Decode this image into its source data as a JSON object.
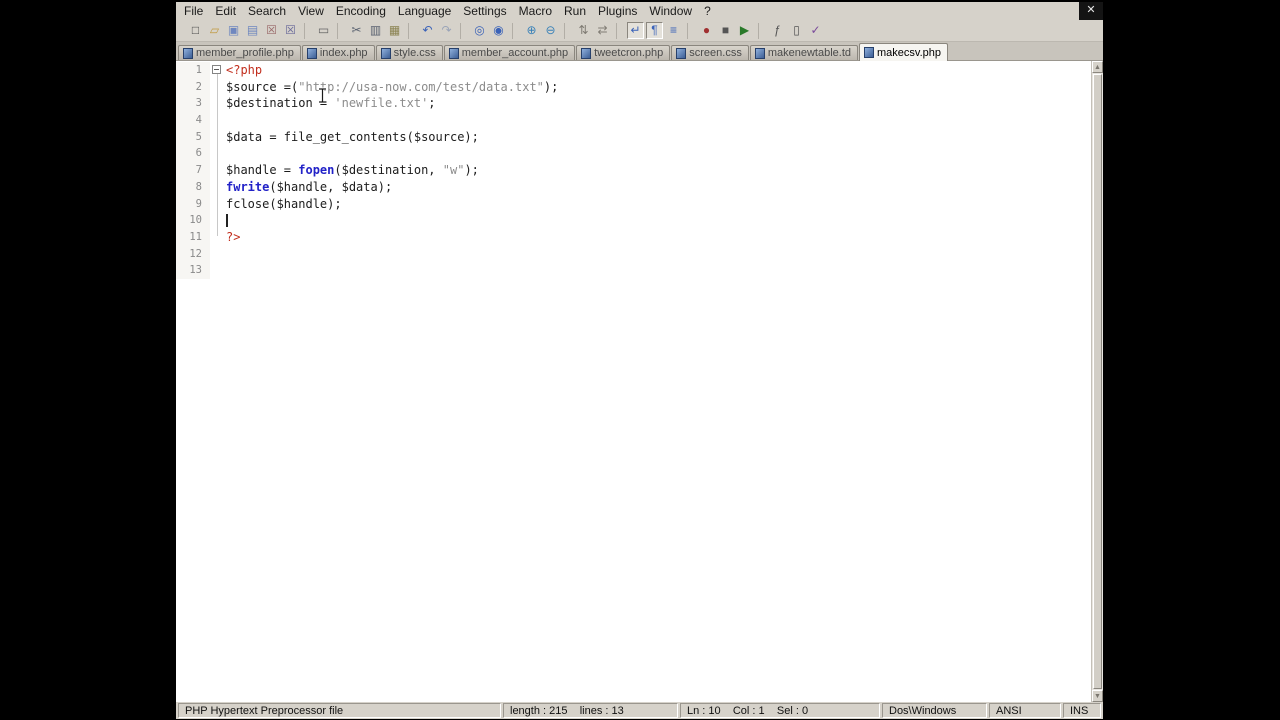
{
  "window": {
    "close_label": "✕"
  },
  "menu": {
    "items": [
      {
        "id": "file",
        "label": "File"
      },
      {
        "id": "edit",
        "label": "Edit"
      },
      {
        "id": "search",
        "label": "Search"
      },
      {
        "id": "view",
        "label": "View"
      },
      {
        "id": "encoding",
        "label": "Encoding"
      },
      {
        "id": "language",
        "label": "Language"
      },
      {
        "id": "settings",
        "label": "Settings"
      },
      {
        "id": "macro",
        "label": "Macro"
      },
      {
        "id": "run",
        "label": "Run"
      },
      {
        "id": "plugins",
        "label": "Plugins"
      },
      {
        "id": "window",
        "label": "Window"
      },
      {
        "id": "help",
        "label": "?"
      }
    ]
  },
  "toolbar": {
    "items": [
      {
        "id": "new-file",
        "glyph": "□",
        "color": "#4a4a4a"
      },
      {
        "id": "open-file",
        "glyph": "▱",
        "color": "#c09a40"
      },
      {
        "id": "save",
        "glyph": "▣",
        "color": "#6f87bf"
      },
      {
        "id": "save-all",
        "glyph": "▤",
        "color": "#6f87bf"
      },
      {
        "id": "close-document",
        "glyph": "☒",
        "color": "#9a6a6a"
      },
      {
        "id": "close-all-documents",
        "glyph": "☒",
        "color": "#6a6a9a"
      },
      {
        "sep": true
      },
      {
        "id": "print",
        "glyph": "▭",
        "color": "#666666"
      },
      {
        "sep": true
      },
      {
        "id": "cut",
        "glyph": "✂",
        "color": "#5a6270"
      },
      {
        "id": "copy",
        "glyph": "▥",
        "color": "#5a6270"
      },
      {
        "id": "paste",
        "glyph": "▦",
        "color": "#8a8250"
      },
      {
        "sep": true
      },
      {
        "id": "undo",
        "glyph": "↶",
        "color": "#3a62b8"
      },
      {
        "id": "redo",
        "glyph": "↷",
        "color": "#9aa4b8"
      },
      {
        "sep": true
      },
      {
        "id": "find",
        "glyph": "◎",
        "color": "#3a62b8"
      },
      {
        "id": "replace",
        "glyph": "◉",
        "color": "#3a62b8"
      },
      {
        "sep": true
      },
      {
        "id": "zoom-in",
        "glyph": "⊕",
        "color": "#3a82b8"
      },
      {
        "id": "zoom-out",
        "glyph": "⊖",
        "color": "#3a82b8"
      },
      {
        "sep": true
      },
      {
        "id": "sync-vertical-scrolling",
        "glyph": "⇅",
        "color": "#807c74"
      },
      {
        "id": "sync-horizontal-scrolling",
        "glyph": "⇄",
        "color": "#807c74"
      },
      {
        "sep": true
      },
      {
        "id": "word-wrap",
        "glyph": "↵",
        "color": "#3a62b8",
        "pressed": true
      },
      {
        "id": "show-all-characters",
        "glyph": "¶",
        "color": "#3a62b8",
        "pressed": true
      },
      {
        "id": "indent-guide",
        "glyph": "≡",
        "color": "#3a62b8"
      },
      {
        "sep": true
      },
      {
        "id": "record-macro",
        "glyph": "●",
        "color": "#a03030"
      },
      {
        "id": "stop-macro",
        "glyph": "■",
        "color": "#555555"
      },
      {
        "id": "play-macro",
        "glyph": "▶",
        "color": "#2a7a2a"
      },
      {
        "sep": true
      },
      {
        "id": "function-list",
        "glyph": "ƒ",
        "color": "#555555"
      },
      {
        "id": "document-map",
        "glyph": "▯",
        "color": "#555555"
      },
      {
        "id": "monitoring",
        "glyph": "✓",
        "color": "#7a4a9a"
      }
    ]
  },
  "tabs": [
    {
      "label": "member_profile.php",
      "active": false
    },
    {
      "label": "index.php",
      "active": false
    },
    {
      "label": "style.css",
      "active": false
    },
    {
      "label": "member_account.php",
      "active": false
    },
    {
      "label": "tweetcron.php",
      "active": false
    },
    {
      "label": "screen.css",
      "active": false
    },
    {
      "label": "makenewtable.td",
      "active": false
    },
    {
      "label": "makecsv.php",
      "active": true
    }
  ],
  "editor": {
    "caret": {
      "line": 10,
      "col": 1
    },
    "lines": [
      {
        "num": 1,
        "fold": "minus",
        "tokens": [
          {
            "s": "phptag",
            "t": "<?php"
          }
        ]
      },
      {
        "num": 2,
        "tokens": [
          {
            "s": "default",
            "t": "$source =("
          },
          {
            "s": "string",
            "t": "\"http://usa-now.com/test/data.txt\""
          },
          {
            "s": "default",
            "t": ");"
          }
        ]
      },
      {
        "num": 3,
        "tokens": [
          {
            "s": "default",
            "t": "$destination = "
          },
          {
            "s": "string",
            "t": "'newfile.txt'"
          },
          {
            "s": "default",
            "t": ";"
          }
        ]
      },
      {
        "num": 4,
        "tokens": []
      },
      {
        "num": 5,
        "tokens": [
          {
            "s": "default",
            "t": "$data = file_get_contents($source);"
          }
        ]
      },
      {
        "num": 6,
        "tokens": []
      },
      {
        "num": 7,
        "tokens": [
          {
            "s": "default",
            "t": "$handle = "
          },
          {
            "s": "keyword",
            "t": "fopen"
          },
          {
            "s": "default",
            "t": "($destination, "
          },
          {
            "s": "string",
            "t": "\"w\""
          },
          {
            "s": "default",
            "t": ");"
          }
        ]
      },
      {
        "num": 8,
        "tokens": [
          {
            "s": "keyword",
            "t": "fwrite"
          },
          {
            "s": "default",
            "t": "($handle, $data);"
          }
        ]
      },
      {
        "num": 9,
        "tokens": [
          {
            "s": "default",
            "t": "fclose($handle);"
          }
        ]
      },
      {
        "num": 10,
        "tokens": []
      },
      {
        "num": 11,
        "tokens": [
          {
            "s": "phptag",
            "t": "?>"
          }
        ]
      },
      {
        "num": 12,
        "tokens": []
      },
      {
        "num": 13,
        "tokens": []
      }
    ]
  },
  "status_bar": {
    "doc_type": "PHP Hypertext Preprocessor file",
    "length_lines": "length : 215    lines : 13",
    "position": "Ln : 10    Col : 1    Sel : 0",
    "eol": "Dos\\Windows",
    "encoding": "ANSI",
    "insert_mode": "INS"
  }
}
